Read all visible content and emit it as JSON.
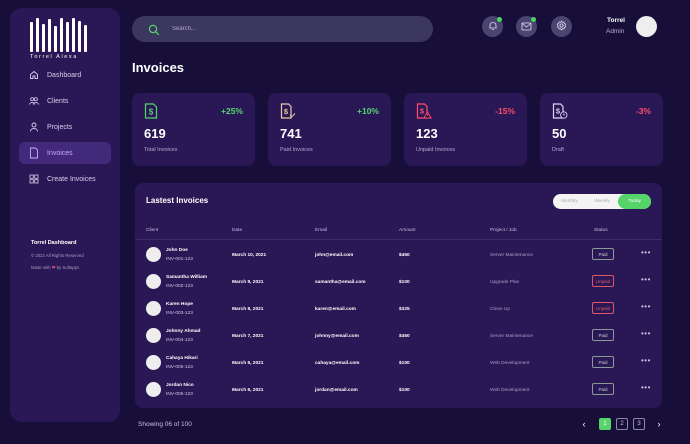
{
  "brand": {
    "logo_text": "Torrel Alexa"
  },
  "sidebar": {
    "items": [
      {
        "label": "Dashboard",
        "icon": "home-icon"
      },
      {
        "label": "Clients",
        "icon": "users-icon"
      },
      {
        "label": "Projects",
        "icon": "user-icon"
      },
      {
        "label": "Invoices",
        "icon": "document-icon",
        "active": true
      },
      {
        "label": "Create Invoices",
        "icon": "grid-icon"
      }
    ],
    "footer": {
      "title": "Torrel Dashboard",
      "copyright": "© 2022 All Rights Reserved",
      "made_prefix": "Made with",
      "made_suffix": "by Softapps"
    }
  },
  "header": {
    "search_placeholder": "Search...",
    "user_name": "Torrel",
    "user_role": "Admin"
  },
  "page": {
    "title": "Invoices"
  },
  "stats": [
    {
      "value": "619",
      "label": "Total Invoices",
      "change": "+25%",
      "trend": "up",
      "icon": "dollar-document-icon",
      "icon_color": "#55d46a"
    },
    {
      "value": "741",
      "label": "Paid Invoices",
      "change": "+10%",
      "trend": "up",
      "icon": "dollar-check-icon",
      "icon_color": "#e9c9a4"
    },
    {
      "value": "123",
      "label": "Unpaid Invoices",
      "change": "-15%",
      "trend": "down",
      "icon": "dollar-warning-icon",
      "icon_color": "#ff4d6a"
    },
    {
      "value": "50",
      "label": "Draft",
      "change": "-3%",
      "trend": "down",
      "icon": "dollar-clock-icon",
      "icon_color": "#d9d4ee"
    }
  ],
  "table": {
    "title": "Lastest Invoices",
    "filters": [
      "Monthly",
      "Weekly",
      "Today"
    ],
    "active_filter": "Today",
    "columns": [
      "Client",
      "Date",
      "Email",
      "Amount",
      "Project / Job",
      "Status"
    ],
    "rows": [
      {
        "name": "John Doe",
        "id": "INV-001-123",
        "date": "March 10, 2021",
        "email": "john@email.com",
        "amount": "$450",
        "project": "Server Maintenance",
        "status": "Paid"
      },
      {
        "name": "Samantha William",
        "id": "INV-002-123",
        "date": "March 9, 2021",
        "email": "samantha@email.com",
        "amount": "$100",
        "project": "Upgrade Plan",
        "status": "Unpaid"
      },
      {
        "name": "Karen Hope",
        "id": "INV-003-123",
        "date": "March 8, 2021",
        "email": "karen@email.com",
        "amount": "$325",
        "project": "Clean Up",
        "status": "Unpaid"
      },
      {
        "name": "Johnny Ahmad",
        "id": "INV-004-123",
        "date": "March 7, 2021",
        "email": "johnny@email.com",
        "amount": "$450",
        "project": "Server Maintenance",
        "status": "Paid"
      },
      {
        "name": "Cahaya Hikari",
        "id": "INV-005-123",
        "date": "March 6, 2021",
        "email": "cahaya@email.com",
        "amount": "$100",
        "project": "Web Development",
        "status": "Paid"
      },
      {
        "name": "Jordan Nico",
        "id": "INV-005-123",
        "date": "March 6, 2021",
        "email": "jordan@email.com",
        "amount": "$100",
        "project": "Web Development",
        "status": "Paid"
      }
    ]
  },
  "pagination": {
    "showing": "Showing 06 of 100",
    "pages": [
      "1",
      "2",
      "3"
    ],
    "current": "1"
  },
  "colors": {
    "accent_green": "#55d46a",
    "accent_red": "#ff4d6a",
    "panel": "#2a1856",
    "background": "#170e3a"
  }
}
